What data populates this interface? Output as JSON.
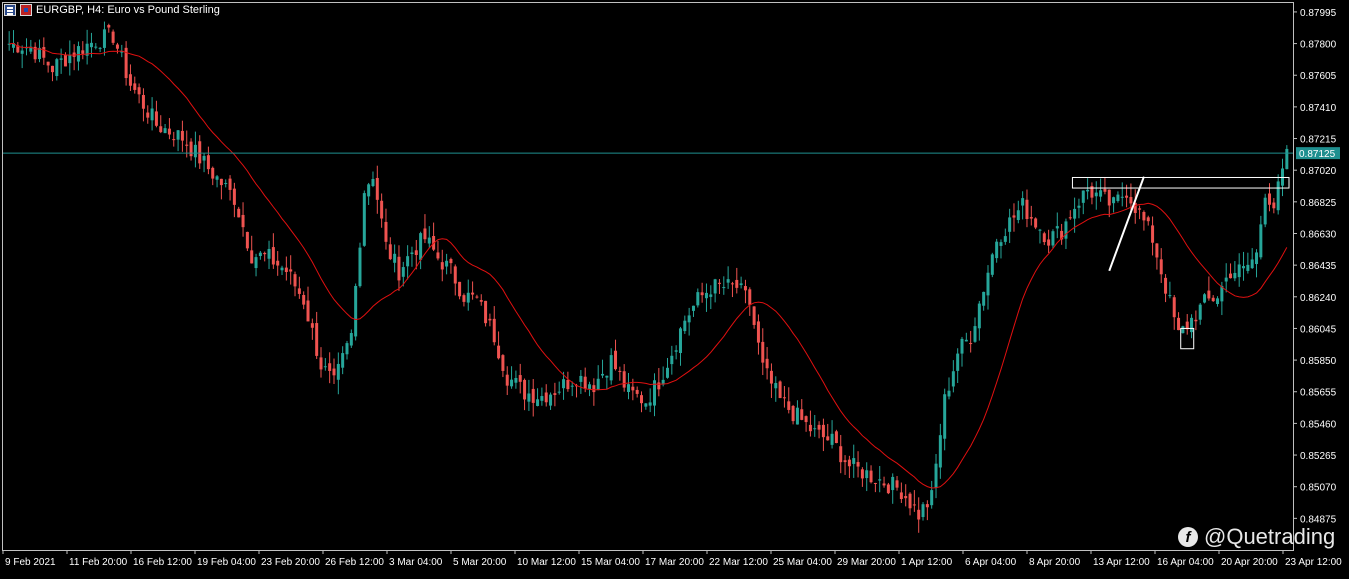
{
  "header": {
    "symbol_line": "EURGBP, H4:  Euro vs Pound Sterling"
  },
  "watermark": {
    "text": "@Quetrading",
    "icon": "quetrading-logo-icon"
  },
  "colors": {
    "background": "#000000",
    "bull": "#26a69a",
    "bear": "#ef5350",
    "ma": "#e01010",
    "price_line": "#1f8f8f",
    "axis_text": "#ffffff"
  },
  "chart_data": {
    "type": "candlestick",
    "symbol": "EURGBP",
    "timeframe": "H4",
    "ylim": [
      0.8468,
      0.8805
    ],
    "y_ticks": [
      "0.87995",
      "0.87800",
      "0.87605",
      "0.87410",
      "0.87215",
      "0.87020",
      "0.86825",
      "0.86630",
      "0.86435",
      "0.86240",
      "0.86045",
      "0.85850",
      "0.85655",
      "0.85460",
      "0.85265",
      "0.85070",
      "0.84875"
    ],
    "current_price": "0.87125",
    "x_labels": [
      "9 Feb 2021",
      "11 Feb 20:00",
      "16 Feb 12:00",
      "19 Feb 04:00",
      "23 Feb 20:00",
      "26 Feb 12:00",
      "3 Mar 04:00",
      "5 Mar 20:00",
      "10 Mar 12:00",
      "15 Mar 04:00",
      "17 Mar 20:00",
      "22 Mar 12:00",
      "25 Mar 04:00",
      "29 Mar 20:00",
      "1 Apr 12:00",
      "6 Apr 04:00",
      "8 Apr 20:00",
      "13 Apr 12:00",
      "16 Apr 04:00",
      "20 Apr 20:00",
      "23 Apr 12:00"
    ],
    "close_path": [
      [
        0,
        0.878
      ],
      [
        5,
        0.8778
      ],
      [
        10,
        0.8765
      ],
      [
        15,
        0.8775
      ],
      [
        20,
        0.8782
      ],
      [
        24,
        0.8785
      ],
      [
        28,
        0.8755
      ],
      [
        34,
        0.873
      ],
      [
        40,
        0.8722
      ],
      [
        46,
        0.8703
      ],
      [
        52,
        0.8685
      ],
      [
        56,
        0.865
      ],
      [
        60,
        0.8648
      ],
      [
        64,
        0.864
      ],
      [
        68,
        0.8622
      ],
      [
        72,
        0.8582
      ],
      [
        75,
        0.857
      ],
      [
        79,
        0.86
      ],
      [
        82,
        0.869
      ],
      [
        84,
        0.87
      ],
      [
        87,
        0.8655
      ],
      [
        90,
        0.864
      ],
      [
        93,
        0.8652
      ],
      [
        96,
        0.866
      ],
      [
        99,
        0.8648
      ],
      [
        102,
        0.864
      ],
      [
        105,
        0.8625
      ],
      [
        108,
        0.8622
      ],
      [
        112,
        0.86
      ],
      [
        115,
        0.8575
      ],
      [
        119,
        0.8565
      ],
      [
        123,
        0.8563
      ],
      [
        127,
        0.8568
      ],
      [
        131,
        0.8575
      ],
      [
        135,
        0.857
      ],
      [
        139,
        0.8585
      ],
      [
        143,
        0.8565
      ],
      [
        147,
        0.856
      ],
      [
        150,
        0.8572
      ],
      [
        153,
        0.859
      ],
      [
        156,
        0.861
      ],
      [
        159,
        0.8622
      ],
      [
        162,
        0.863
      ],
      [
        165,
        0.863
      ],
      [
        168,
        0.863
      ],
      [
        171,
        0.862
      ],
      [
        174,
        0.858
      ],
      [
        178,
        0.856
      ],
      [
        182,
        0.855
      ],
      [
        186,
        0.854
      ],
      [
        190,
        0.8535
      ],
      [
        194,
        0.852
      ],
      [
        198,
        0.8515
      ],
      [
        202,
        0.851
      ],
      [
        206,
        0.8505
      ],
      [
        210,
        0.849
      ],
      [
        213,
        0.85
      ],
      [
        216,
        0.856
      ],
      [
        219,
        0.859
      ],
      [
        222,
        0.86
      ],
      [
        225,
        0.863
      ],
      [
        228,
        0.866
      ],
      [
        231,
        0.867
      ],
      [
        234,
        0.868
      ],
      [
        237,
        0.867
      ],
      [
        240,
        0.866
      ],
      [
        243,
        0.8665
      ],
      [
        246,
        0.868
      ],
      [
        249,
        0.869
      ],
      [
        252,
        0.8685
      ],
      [
        255,
        0.868
      ],
      [
        258,
        0.869
      ],
      [
        261,
        0.8675
      ],
      [
        264,
        0.866
      ],
      [
        267,
        0.863
      ],
      [
        270,
        0.86
      ],
      [
        273,
        0.861
      ],
      [
        276,
        0.862
      ],
      [
        279,
        0.8625
      ],
      [
        282,
        0.864
      ],
      [
        285,
        0.864
      ],
      [
        288,
        0.865
      ],
      [
        290,
        0.869
      ],
      [
        292,
        0.868
      ],
      [
        294,
        0.87
      ],
      [
        295,
        0.871
      ]
    ],
    "ma_period": 20,
    "annotations": [
      {
        "type": "rectangle",
        "price_top": 0.86975,
        "price_bottom": 0.8691,
        "start_index": 246,
        "end_index": 295
      },
      {
        "type": "trendline",
        "from": [
          254,
          0.864
        ],
        "to": [
          262,
          0.8698
        ]
      },
      {
        "type": "rectangle",
        "price_top": 0.86045,
        "price_bottom": 0.8592,
        "start_index": 271,
        "end_index": 273
      }
    ]
  }
}
